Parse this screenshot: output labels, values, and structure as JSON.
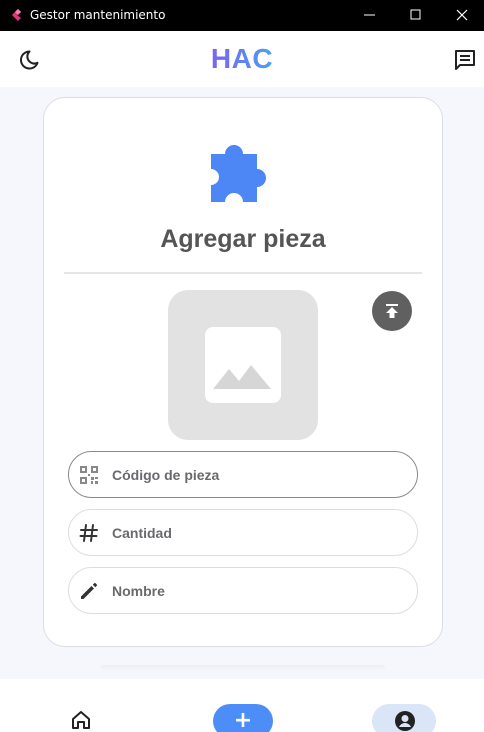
{
  "window": {
    "title": "Gestor mantenimiento",
    "controls": [
      "minimize",
      "maximize",
      "close"
    ]
  },
  "header": {
    "brand": "HAC",
    "theme_icon": "moon-icon",
    "chat_icon": "chat-icon"
  },
  "form": {
    "icon": "puzzle-icon",
    "title": "Agregar pieza",
    "image_placeholder_icon": "image-icon",
    "upload_icon": "upload-icon",
    "fields": [
      {
        "icon": "qr-code-icon",
        "placeholder": "Código de pieza"
      },
      {
        "icon": "hash-icon",
        "placeholder": "Cantidad"
      },
      {
        "icon": "pencil-icon",
        "placeholder": "Nombre"
      }
    ]
  },
  "bottom_nav": {
    "home_icon": "home-icon",
    "add_label": "+",
    "profile_icon": "account-icon"
  },
  "colors": {
    "accent": "#4d8df7",
    "puzzle": "#4d86f5",
    "brand_start": "#7a63f4",
    "brand_end": "#4aa0f0",
    "profile_pill": "#dbe5f8"
  }
}
